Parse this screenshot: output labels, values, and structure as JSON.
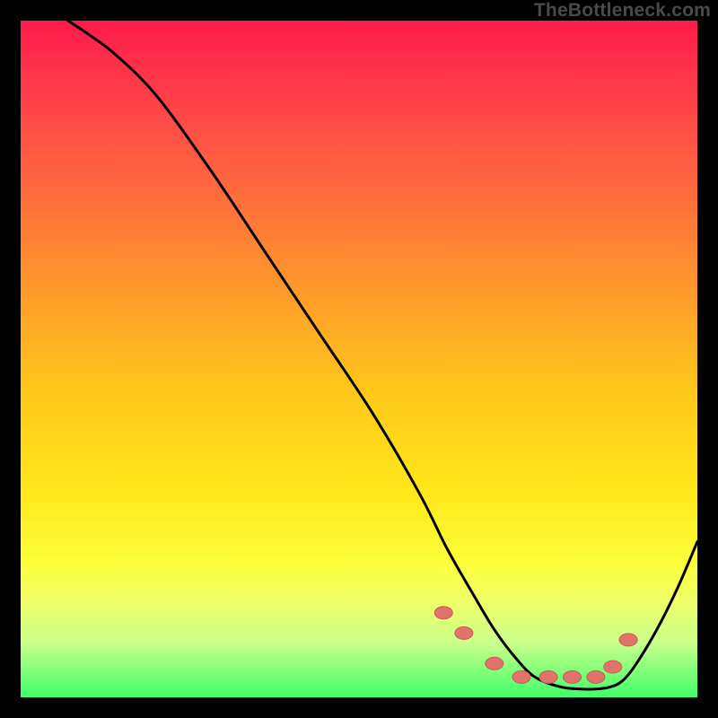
{
  "watermark": {
    "text": "TheBottleneck.com"
  },
  "colors": {
    "curve_stroke": "#000000",
    "marker_fill": "#e2736b",
    "marker_stroke": "#cc5a52"
  },
  "chart_data": {
    "type": "line",
    "title": "",
    "xlabel": "",
    "ylabel": "",
    "xlim": [
      0,
      100
    ],
    "ylim": [
      0,
      100
    ],
    "curve": {
      "x": [
        7,
        10,
        14,
        20,
        28,
        36,
        44,
        52,
        59,
        63,
        67,
        70,
        73,
        76,
        80,
        84,
        87,
        89,
        91,
        94,
        97,
        100
      ],
      "y": [
        100,
        98,
        95,
        89,
        78,
        66,
        54,
        42,
        30,
        22,
        15,
        10,
        6,
        3,
        1.5,
        1.2,
        1.5,
        2.5,
        5,
        10,
        16,
        23
      ]
    },
    "markers": {
      "x": [
        62.5,
        65.5,
        70,
        74,
        78,
        81.5,
        85,
        87.5,
        89.8
      ],
      "y": [
        12.5,
        9.5,
        5,
        3,
        3,
        3,
        3,
        4.5,
        8.5
      ]
    }
  }
}
